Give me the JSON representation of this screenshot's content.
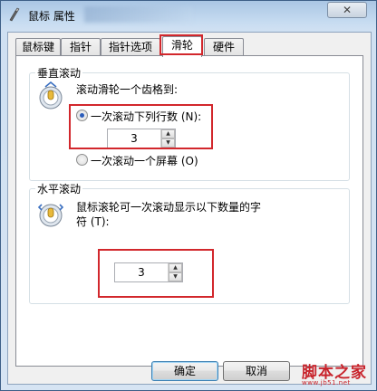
{
  "window": {
    "title": "鼠标 属性",
    "close_label": "✕"
  },
  "tabs": [
    {
      "label": "鼠标键"
    },
    {
      "label": "指针"
    },
    {
      "label": "指针选项"
    },
    {
      "label": "滑轮"
    },
    {
      "label": "硬件"
    }
  ],
  "vertical": {
    "group_label": "垂直滚动",
    "description": "滚动滑轮一个齿格到:",
    "option_lines": "一次滚动下列行数 (N):",
    "lines_value": "3",
    "option_screen": "一次滚动一个屏幕 (O)",
    "selected": "lines"
  },
  "horizontal": {
    "group_label": "水平滚动",
    "description_line1": "鼠标滚轮可一次滚动显示以下数量的字",
    "description_line2": "符 (T):",
    "chars_value": "3"
  },
  "buttons": {
    "ok": "确定",
    "cancel": "取消"
  },
  "watermark": {
    "brand": "脚本之家",
    "url": "www.jb51.net"
  }
}
